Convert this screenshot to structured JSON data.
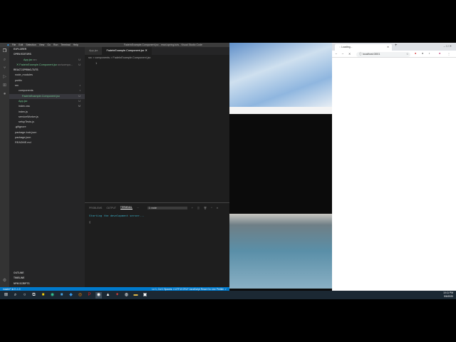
{
  "vscode": {
    "menu": [
      "File",
      "Edit",
      "Selection",
      "View",
      "Go",
      "Run",
      "Terminal",
      "Help"
    ],
    "window_title": "FadeInExample.Component.jsx - react-spring-tuts - Visual Studio Code",
    "explorer_title": "EXPLORER",
    "open_editors_title": "OPEN EDITORS",
    "open_editors": [
      {
        "name": "App.jsx",
        "hint": "src",
        "badge": "U"
      },
      {
        "name": "FadeInExample.Component.jsx",
        "hint": "src\\compo...",
        "badge": "U"
      }
    ],
    "project_title": "REACT-SPRING-TUTS",
    "tree": [
      {
        "name": "node_modules",
        "indent": 0,
        "badge": ""
      },
      {
        "name": "public",
        "indent": 0,
        "badge": ""
      },
      {
        "name": "src",
        "indent": 0,
        "badge": "•"
      },
      {
        "name": "components",
        "indent": 1,
        "badge": "•"
      },
      {
        "name": "FadeInExample.Component.jsx",
        "indent": 2,
        "badge": "U"
      },
      {
        "name": "App.jsx",
        "indent": 1,
        "badge": "U"
      },
      {
        "name": "index.css",
        "indent": 1,
        "badge": "M"
      },
      {
        "name": "index.js",
        "indent": 1,
        "badge": ""
      },
      {
        "name": "serviceWorker.js",
        "indent": 1,
        "badge": ""
      },
      {
        "name": "setupTests.js",
        "indent": 1,
        "badge": ""
      },
      {
        "name": ".gitignore",
        "indent": 0,
        "badge": ""
      },
      {
        "name": "package-lock.json",
        "indent": 0,
        "badge": ""
      },
      {
        "name": "package.json",
        "indent": 0,
        "badge": ""
      },
      {
        "name": "README.md",
        "indent": 0,
        "badge": ""
      }
    ],
    "bottom_sections": [
      "OUTLINE",
      "TIMELINE",
      "NPM SCRIPTS"
    ],
    "tabs": [
      {
        "label": "App.jsx"
      },
      {
        "label": "FadeInExample.Component.jsx"
      }
    ],
    "breadcrumb": "src > components > FadeInExample.Component.jsx",
    "line_number": "1",
    "panel_tabs": [
      "PROBLEMS",
      "OUTPUT",
      "TERMINAL"
    ],
    "terminal_select": "1: node",
    "terminal_output": "Starting the development server...",
    "status_left": "master*  ⊗ 0 ⚠ 0",
    "status_right": "Ln 1, Col 1   Spaces: 4   UTF-8   CRLF   JavaScript React   Go Live   Prettier ✓"
  },
  "chrome": {
    "tab_title": "Loading...",
    "url": "localhost:3001"
  },
  "taskbar": {
    "time": "10:11 PM",
    "date": "5/6/2020"
  }
}
